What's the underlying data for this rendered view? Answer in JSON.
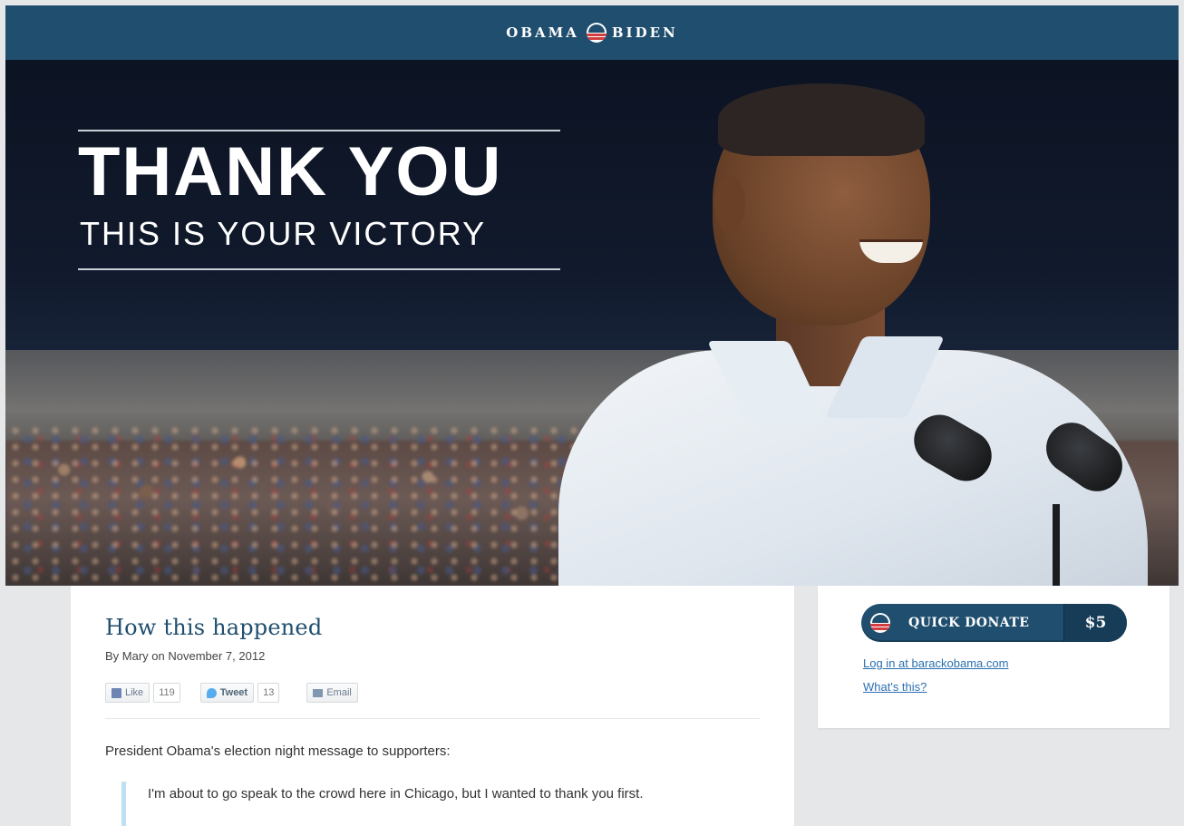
{
  "topbar": {
    "brand_left": "OBAMA",
    "brand_right": "BIDEN",
    "logo_icon": "obama-logo-icon",
    "background": "#1f4e6e"
  },
  "hero": {
    "headline": "THANK YOU",
    "subheadline": "THIS IS YOUR VICTORY"
  },
  "article": {
    "title": "How this happened",
    "byline": "By Mary on November 7, 2012",
    "share": {
      "like_label": "Like",
      "like_count": "119",
      "tweet_label": "Tweet",
      "tweet_count": "13",
      "email_label": "Email"
    },
    "intro": "President Obama's election night message to supporters:",
    "quote": "I'm about to go speak to the crowd here in Chicago, but I wanted to thank you first."
  },
  "sidebar": {
    "donate_label": "QUICK DONATE",
    "donate_amount": "$5",
    "login_link": "Log in at barackobama.com",
    "whats_this_link": "What's this?"
  },
  "colors": {
    "brand_blue": "#1f4e6e",
    "link_blue": "#2a6fb0",
    "quote_bar": "#bfe0f2",
    "brand_red": "#d43d3d"
  }
}
